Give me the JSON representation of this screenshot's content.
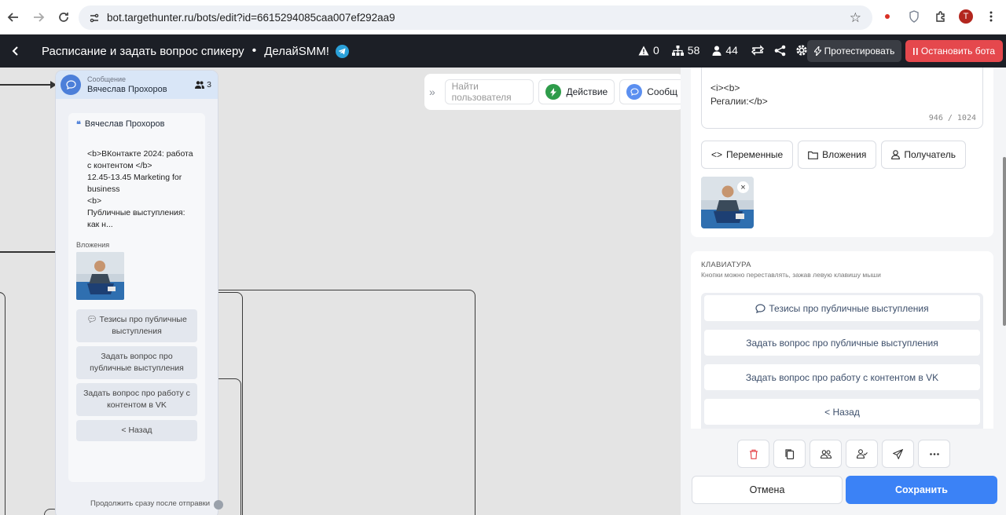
{
  "browser": {
    "url": "bot.targethunter.ru/bots/edit?id=6615294085caa007ef292aa9",
    "avatar_letter": "Т"
  },
  "header": {
    "title": "Расписание и задать вопрос спикеру",
    "separator": "•",
    "bot_name": "ДелайSMM!",
    "warnings": "0",
    "nodes": "58",
    "users": "44",
    "test_label": "Протестировать",
    "stop_label": "Остановить бота"
  },
  "node": {
    "type": "Сообщение",
    "name": "Вячеслав Прохоров",
    "recipients": "3",
    "quote_name": "Вячеслав Прохоров",
    "text": "<b>ВКонтакте 2024: работа\nс контентом </b>\n12.45-13.45 Marketing for\nbusiness\n<b>\nПубличные выступления:\nкак н...",
    "attachments_label": "Вложения",
    "buttons": [
      "Тезисы про публичные выступления",
      "Задать вопрос про публичные выступления",
      "Задать вопрос про работу с контентом в VK",
      "< Назад"
    ],
    "continue_label": "Продолжить сразу после отправки"
  },
  "toolbar": {
    "search_placeholder": "Найти пользователя",
    "action_label": "Действие",
    "message_label": "Сообщ"
  },
  "panel": {
    "text": "<i><b>\nРегалии:</b>",
    "counter": "946 / 1024",
    "chips": [
      "Переменные",
      "Вложения",
      "Получатель"
    ],
    "keyboard_title": "КЛАВИАТУРА",
    "keyboard_hint": "Кнопки можно переставлять, зажав левую клавишу мыши",
    "keyboard_buttons": [
      "Тезисы про публичные выступления",
      "Задать вопрос про публичные выступления",
      "Задать вопрос про работу с контентом в VK",
      "< Назад"
    ],
    "cancel_label": "Отмена",
    "save_label": "Сохранить"
  }
}
